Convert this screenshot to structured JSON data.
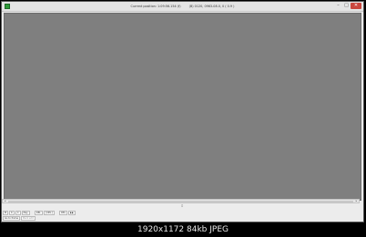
{
  "window": {
    "title_position": "Current position: 1:09:56.154 (f)",
    "title_source": "(B) 0120, 0963-08.0, 0 ( 0.9 )",
    "controls": {
      "minimize": "–",
      "maximize": "□",
      "close": "✕"
    }
  },
  "toolbar": {
    "buttons": [
      "M",
      "K",
      "C",
      "Play",
      "DEL",
      "[ DEL ]",
      "",
      "DEL",
      "▶▶"
    ]
  },
  "bottombar": {
    "goto_label": "Go to frame",
    "mark_label": "Mark edit"
  },
  "caption": {
    "text": "1920x1172 84kb JPEG"
  },
  "colors": {
    "video_background": "#7f7f7f",
    "frame_background": "#000000",
    "window_chrome": "#ececec"
  }
}
